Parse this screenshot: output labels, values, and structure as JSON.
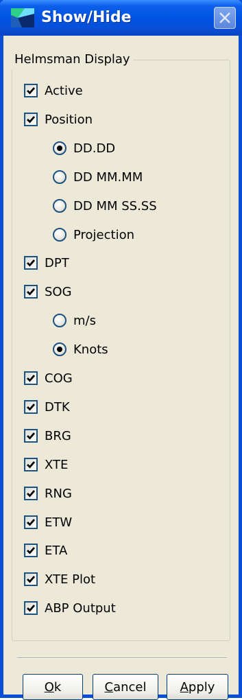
{
  "window": {
    "title": "Show/Hide"
  },
  "icons": {
    "app": "chart-app-icon",
    "close": "close-icon",
    "check": "check-mark-icon"
  },
  "colors": {
    "titlebar": "#0054e3",
    "face": "#ece9d8",
    "border": "#1c5180"
  },
  "group": {
    "label": "Helmsman Display"
  },
  "items": [
    {
      "kind": "checkbox",
      "label": "Active",
      "checked": true
    },
    {
      "kind": "checkbox",
      "label": "Position",
      "checked": true
    },
    {
      "kind": "radio",
      "label": "DD.DD",
      "selected": true
    },
    {
      "kind": "radio",
      "label": "DD MM.MM",
      "selected": false
    },
    {
      "kind": "radio",
      "label": "DD MM SS.SS",
      "selected": false
    },
    {
      "kind": "radio",
      "label": "Projection",
      "selected": false
    },
    {
      "kind": "checkbox",
      "label": "DPT",
      "checked": true
    },
    {
      "kind": "checkbox",
      "label": "SOG",
      "checked": true
    },
    {
      "kind": "radio",
      "label": "m/s",
      "selected": false
    },
    {
      "kind": "radio",
      "label": "Knots",
      "selected": true
    },
    {
      "kind": "checkbox",
      "label": "COG",
      "checked": true
    },
    {
      "kind": "checkbox",
      "label": "DTK",
      "checked": true
    },
    {
      "kind": "checkbox",
      "label": "BRG",
      "checked": true
    },
    {
      "kind": "checkbox",
      "label": "XTE",
      "checked": true
    },
    {
      "kind": "checkbox",
      "label": "RNG",
      "checked": true
    },
    {
      "kind": "checkbox",
      "label": "ETW",
      "checked": true
    },
    {
      "kind": "checkbox",
      "label": "ETA",
      "checked": true
    },
    {
      "kind": "checkbox",
      "label": "XTE Plot",
      "checked": true
    },
    {
      "kind": "checkbox",
      "label": "ABP Output",
      "checked": true
    }
  ],
  "buttons": {
    "ok": {
      "mnemonic": "O",
      "rest": "k"
    },
    "cancel": {
      "mnemonic": "C",
      "rest": "ancel"
    },
    "apply": {
      "mnemonic": "A",
      "rest": "pply"
    }
  }
}
